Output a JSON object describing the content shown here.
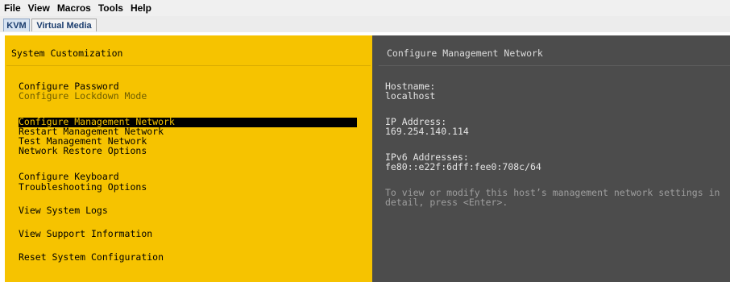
{
  "menubar": {
    "items": [
      "File",
      "View",
      "Macros",
      "Tools",
      "Help"
    ]
  },
  "tabs": {
    "kvm": "KVM",
    "virtual_media": "Virtual Media"
  },
  "left_panel": {
    "title": "System Customization",
    "items": [
      {
        "label": "Configure Password",
        "dim": false
      },
      {
        "label": "Configure Lockdown Mode",
        "dim": true
      },
      {
        "label": "Configure Management Network",
        "selected": true
      },
      {
        "label": "Restart Management Network"
      },
      {
        "label": "Test Management Network"
      },
      {
        "label": "Network Restore Options"
      },
      {
        "label": "Configure Keyboard"
      },
      {
        "label": "Troubleshooting Options"
      },
      {
        "label": "View System Logs"
      },
      {
        "label": "View Support Information"
      },
      {
        "label": "Reset System Configuration"
      }
    ]
  },
  "right_panel": {
    "title": "Configure Management Network",
    "hostname_label": "Hostname:",
    "hostname_value": "localhost",
    "ip_label": "IP Address:",
    "ip_value": "169.254.140.114",
    "ipv6_label": "IPv6 Addresses:",
    "ipv6_value": "fe80::e22f:6dff:fee0:708c/64",
    "help_line1": "To view or modify this host’s management network settings in",
    "help_line2": "detail, press <Enter>."
  },
  "colors": {
    "accent_yellow": "#f6c300",
    "panel_dark": "#4c4c4c",
    "selection": "#000000"
  }
}
